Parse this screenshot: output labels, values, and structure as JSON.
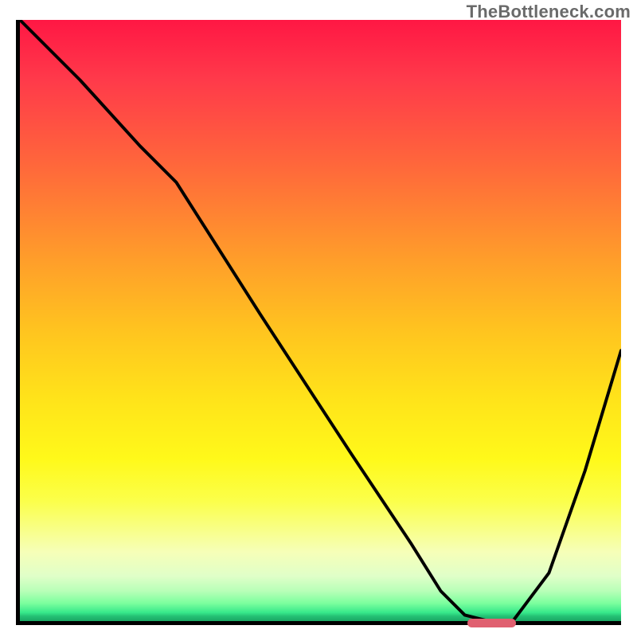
{
  "watermark": "TheBottleneck.com",
  "colors": {
    "top": "#ff1744",
    "mid": "#ffe31a",
    "bottom": "#1aa864",
    "marker": "#e06070",
    "curve": "#000000",
    "axis": "#000000"
  },
  "chart_data": {
    "type": "line",
    "title": "",
    "xlabel": "",
    "ylabel": "",
    "xlim": [
      0,
      100
    ],
    "ylim": [
      0,
      100
    ],
    "grid": false,
    "legend": false,
    "series": [
      {
        "name": "curve",
        "x": [
          0,
          10,
          20,
          26,
          40,
          55,
          65,
          70,
          74,
          78,
          82,
          88,
          94,
          100
        ],
        "y": [
          100,
          90,
          79,
          73,
          51,
          28,
          13,
          5,
          1,
          0,
          0,
          8,
          25,
          45
        ]
      }
    ],
    "marker": {
      "x_start": 74,
      "x_end": 82,
      "y": 0
    }
  }
}
